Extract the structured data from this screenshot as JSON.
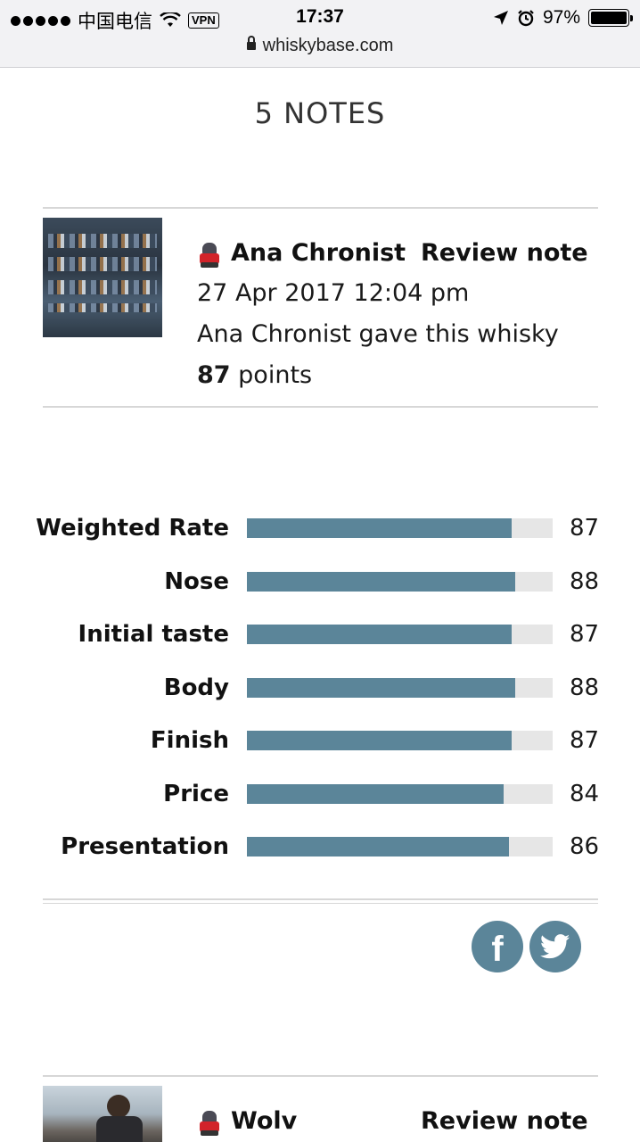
{
  "status_bar": {
    "carrier": "中国电信",
    "vpn": "VPN",
    "time": "17:37",
    "battery": "97%",
    "icons": [
      "signal-dots-icon",
      "wifi-icon",
      "location-arrow-icon",
      "alarm-icon",
      "battery-icon"
    ]
  },
  "browser": {
    "url": "whiskybase.com"
  },
  "page": {
    "title": "5 NOTES"
  },
  "notes": [
    {
      "user": "Ana Chronist",
      "type": "Review note",
      "date": "27 Apr 2017 12:04 pm",
      "summary": "Ana Chronist gave this whisky",
      "points": "87",
      "points_suffix": "points"
    },
    {
      "user": "Wolv",
      "type": "Review note"
    }
  ],
  "ratings": [
    {
      "label": "Weighted Rate",
      "value": "87",
      "fill": 0.867
    },
    {
      "label": "Nose",
      "value": "88",
      "fill": 0.879
    },
    {
      "label": "Initial taste",
      "value": "87",
      "fill": 0.867
    },
    {
      "label": "Body",
      "value": "88",
      "fill": 0.879
    },
    {
      "label": "Finish",
      "value": "87",
      "fill": 0.867
    },
    {
      "label": "Price",
      "value": "84",
      "fill": 0.839
    },
    {
      "label": "Presentation",
      "value": "86",
      "fill": 0.858
    }
  ],
  "share": {
    "icons": [
      "facebook-icon",
      "twitter-icon"
    ]
  },
  "colors": {
    "accent": "#5b8599",
    "track": "#e6e6e6"
  }
}
